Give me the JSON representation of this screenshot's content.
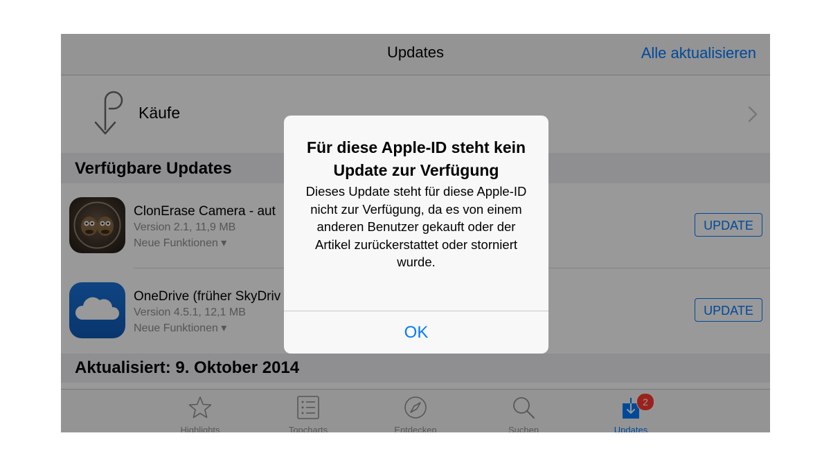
{
  "navbar": {
    "title": "Updates",
    "action": "Alle aktualisieren"
  },
  "purchases": {
    "label": "Käufe"
  },
  "sections": {
    "available": "Verfügbare Updates",
    "updated": "Aktualisiert: 9. Oktober 2014"
  },
  "apps": [
    {
      "name": "ClonErase Camera - aut",
      "version": "Version 2.1, 11,9 MB",
      "features": "Neue Funktionen ▾",
      "button": "UPDATE",
      "icon": "clonerase-app-icon"
    },
    {
      "name": "OneDrive (früher SkyDriv",
      "version": "Version 4.5.1, 12,1 MB",
      "features": "Neue Funktionen ▾",
      "button": "UPDATE",
      "icon": "onedrive-app-icon"
    }
  ],
  "tabbar": {
    "tabs": [
      {
        "label": "Highlights",
        "icon": "star-icon"
      },
      {
        "label": "Topcharts",
        "icon": "list-icon"
      },
      {
        "label": "Entdecken",
        "icon": "compass-icon"
      },
      {
        "label": "Suchen",
        "icon": "search-icon"
      },
      {
        "label": "Updates",
        "icon": "updates-icon",
        "active": true
      }
    ],
    "badge": "2"
  },
  "alert": {
    "title": "Für diese Apple-ID steht kein Update zur Verfügung",
    "message": "Dieses Update steht für diese Apple-ID nicht zur Verfügung, da es von einem anderen Benutzer gekauft oder der Artikel zurückerstattet oder storniert wurde.",
    "ok": "OK"
  },
  "colors": {
    "accent": "#007aff",
    "badge": "#ff3b30",
    "dim_overlay": "rgba(0,0,0,0.40)"
  }
}
